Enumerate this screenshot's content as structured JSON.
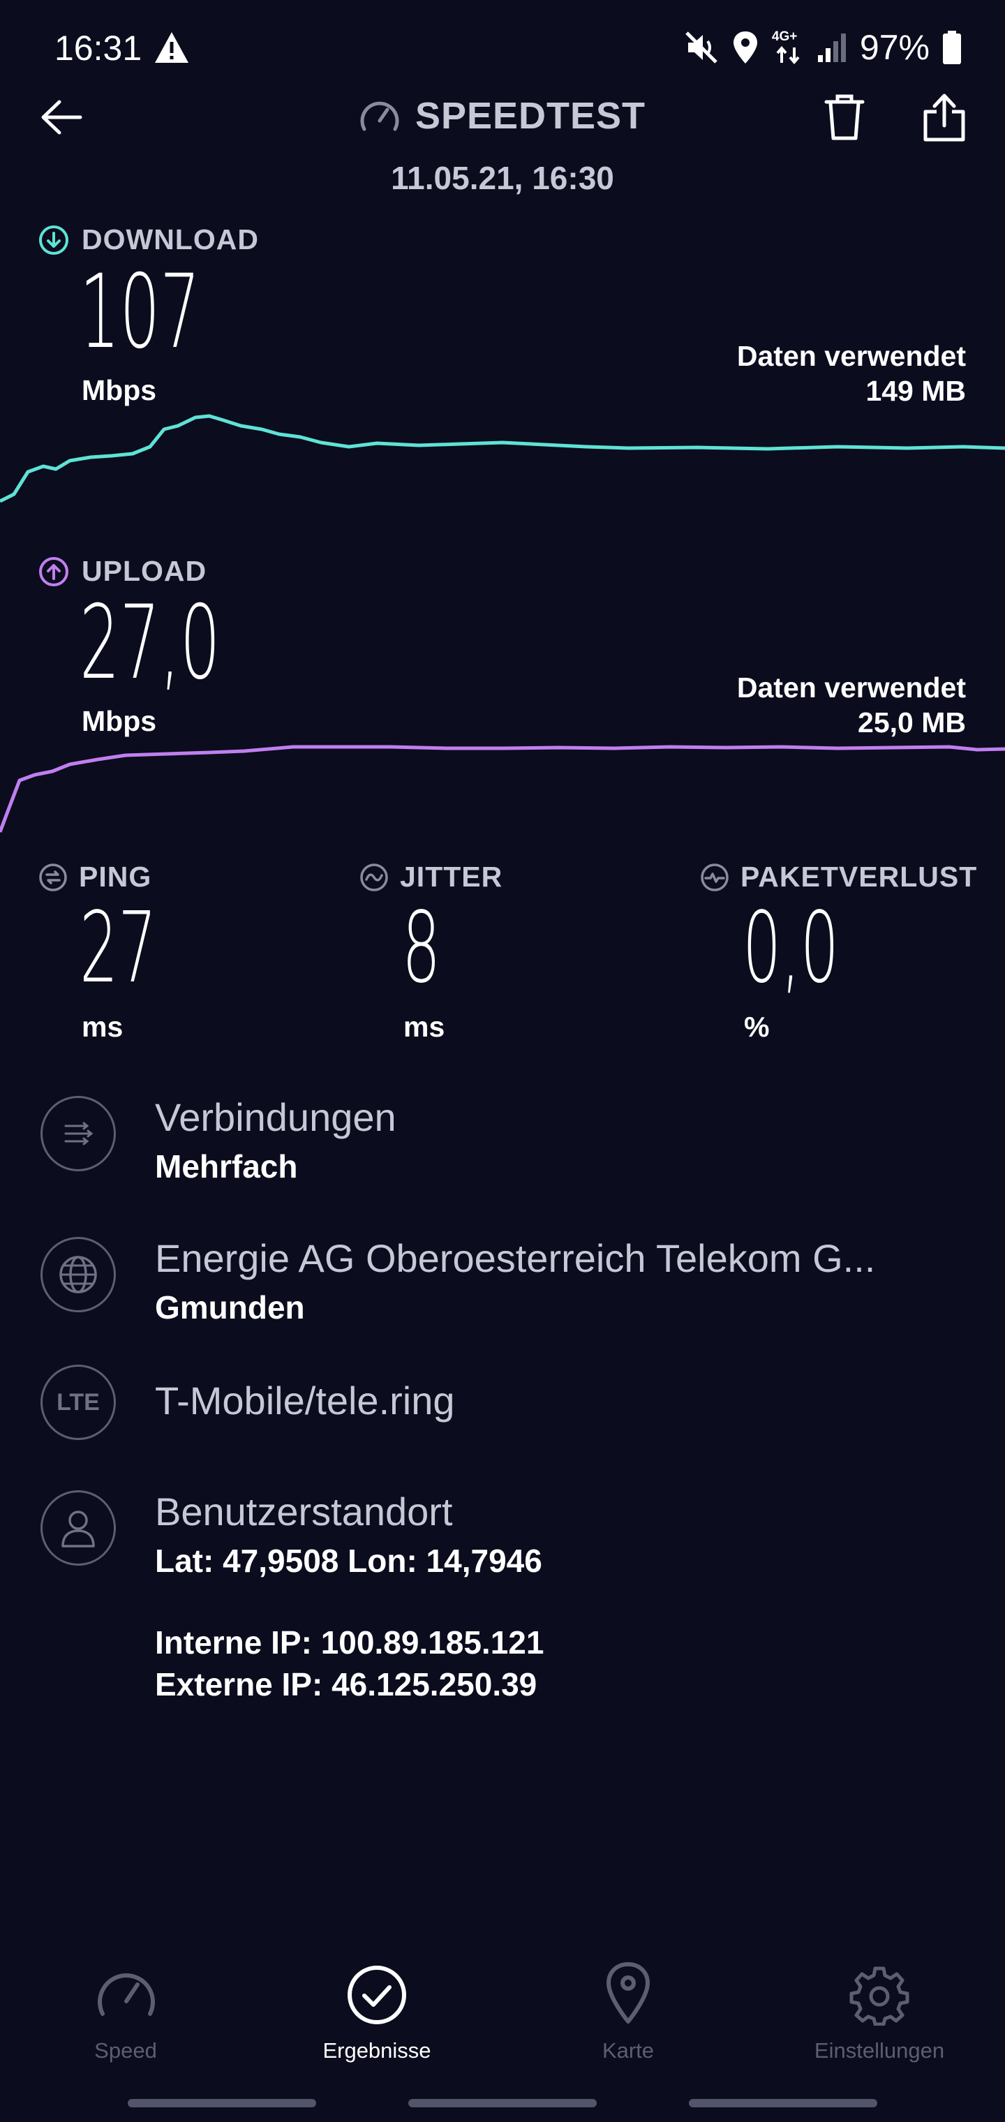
{
  "status_bar": {
    "time": "16:31",
    "network": "4G+",
    "battery": "97%"
  },
  "header": {
    "title": "SPEEDTEST",
    "date": "11.05.21, 16:30"
  },
  "download": {
    "label": "DOWNLOAD",
    "value": "107",
    "unit": "Mbps",
    "data_used_label": "Daten verwendet",
    "data_used_value": "149 MB",
    "color": "#5ee3d6"
  },
  "upload": {
    "label": "UPLOAD",
    "value": "27,0",
    "unit": "Mbps",
    "data_used_label": "Daten verwendet",
    "data_used_value": "25,0 MB",
    "color": "#c07ff0"
  },
  "ping": {
    "label": "PING",
    "value": "27",
    "unit": "ms"
  },
  "jitter": {
    "label": "JITTER",
    "value": "8",
    "unit": "ms"
  },
  "packet_loss": {
    "label": "PAKETVERLUST",
    "value": "0,0",
    "unit": "%"
  },
  "connections": {
    "title": "Verbindungen",
    "value": "Mehrfach"
  },
  "server": {
    "title": "Energie AG Oberoesterreich Telekom G...",
    "location": "Gmunden"
  },
  "carrier": {
    "icon_text": "LTE",
    "name": "T-Mobile/tele.ring"
  },
  "user_location": {
    "title": "Benutzerstandort",
    "coords": "Lat: 47,9508 Lon: 14,7946",
    "internal_ip": "Interne IP: 100.89.185.121",
    "external_ip": "Externe IP: 46.125.250.39"
  },
  "nav": {
    "speed": "Speed",
    "results": "Ergebnisse",
    "map": "Karte",
    "settings": "Einstellungen"
  },
  "icons": {
    "warning": "warning-icon",
    "mute": "vibrate-mute-icon",
    "location": "location-pin-icon",
    "signal": "signal-icon",
    "battery": "battery-icon",
    "back": "back-arrow-icon",
    "speedometer": "speedometer-icon",
    "trash": "trash-icon",
    "share": "share-icon"
  }
}
